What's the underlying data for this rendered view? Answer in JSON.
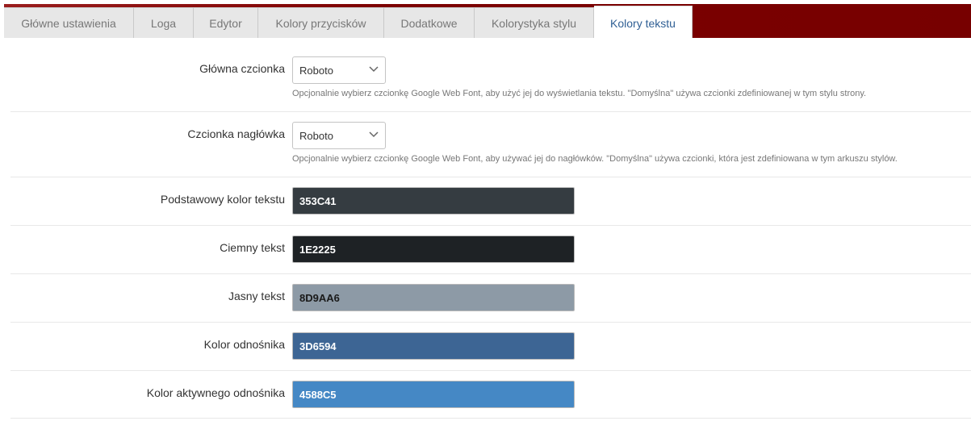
{
  "tabs": [
    {
      "label": "Główne ustawienia",
      "active": false
    },
    {
      "label": "Loga",
      "active": false
    },
    {
      "label": "Edytor",
      "active": false
    },
    {
      "label": "Kolory przycisków",
      "active": false
    },
    {
      "label": "Dodatkowe",
      "active": false
    },
    {
      "label": "Kolorystyka stylu",
      "active": false
    },
    {
      "label": "Kolory tekstu",
      "active": true
    }
  ],
  "fonts": {
    "main": {
      "label": "Główna czcionka",
      "value": "Roboto",
      "help": "Opcjonalnie wybierz czcionkę Google Web Font, aby użyć jej do wyświetlania tekstu. \"Domyślna\" używa czcionki zdefiniowanej w tym stylu strony."
    },
    "heading": {
      "label": "Czcionka nagłówka",
      "value": "Roboto",
      "help": "Opcjonalnie wybierz czcionkę Google Web Font, aby używać jej do nagłówków. \"Domyślna\" używa czcionki, która jest zdefiniowana w tym arkuszu stylów."
    }
  },
  "colors": [
    {
      "label": "Podstawowy kolor tekstu",
      "value": "353C41",
      "bg": "#353C41",
      "fg": "#ffffff"
    },
    {
      "label": "Ciemny tekst",
      "value": "1E2225",
      "bg": "#1E2225",
      "fg": "#ffffff"
    },
    {
      "label": "Jasny tekst",
      "value": "8D9AA6",
      "bg": "#8D9AA6",
      "fg": "#1a1a1a"
    },
    {
      "label": "Kolor odnośnika",
      "value": "3D6594",
      "bg": "#3D6594",
      "fg": "#ffffff"
    },
    {
      "label": "Kolor aktywnego odnośnika",
      "value": "4588C5",
      "bg": "#4588C5",
      "fg": "#ffffff"
    }
  ],
  "icons": {
    "select_arrow": "chevron-down-icon"
  },
  "theme": {
    "tabbar": "#7c0000",
    "active_tab_text": "#2f5f94"
  }
}
